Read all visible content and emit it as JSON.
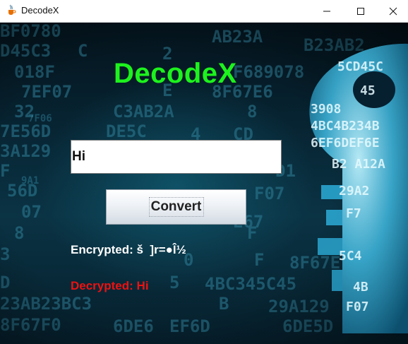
{
  "window": {
    "title": "DecodeX"
  },
  "app": {
    "heading": "DecodeX"
  },
  "input": {
    "value": "Hi"
  },
  "convert_button": {
    "label": "Convert"
  },
  "output": {
    "encrypted_label": "Encrypted:",
    "encrypted_value": "š  ]r=●Î½",
    "decrypted_label": "Decrypted:",
    "decrypted_value": "Hi"
  },
  "colors": {
    "heading": "#1df21d",
    "encrypted_text": "#ffffff",
    "decrypted_text": "#ee1111"
  },
  "icons": {
    "app": "java-coffee-cup-icon",
    "minimize": "minimize-icon",
    "maximize": "maximize-icon",
    "close": "close-icon",
    "background": "digital-key-illustration"
  }
}
